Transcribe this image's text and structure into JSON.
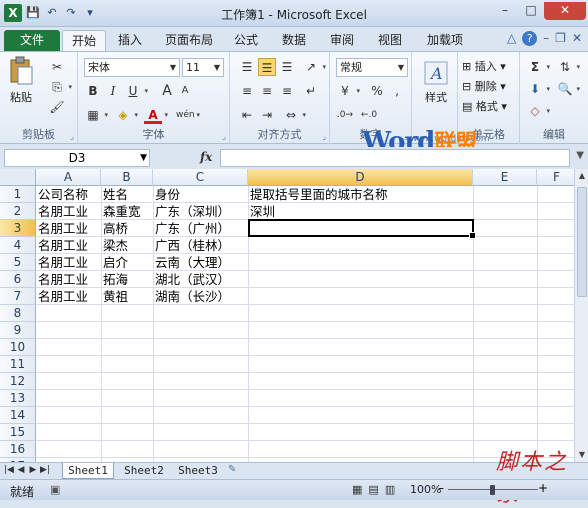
{
  "window": {
    "title": "工作簿1 - Microsoft Excel",
    "controls": [
      "–",
      "□",
      "✕"
    ]
  },
  "qat": {
    "app_icon": "X",
    "save": "💾",
    "undo": "↶",
    "redo": "↷",
    "more": "▾"
  },
  "tabs": [
    "文件",
    "开始",
    "插入",
    "页面布局",
    "公式",
    "数据",
    "审阅",
    "视图",
    "加载项"
  ],
  "ribbon": {
    "clipboard": {
      "paste": "粘贴",
      "label": "剪贴板"
    },
    "font": {
      "name": "宋体",
      "size": "11",
      "bold": "B",
      "italic": "I",
      "underline": "U",
      "grow": "A",
      "shrink": "A",
      "fontcolor": "A",
      "wen": "wén",
      "label": "字体"
    },
    "alignment": {
      "label": "对齐方式"
    },
    "number": {
      "format": "常规",
      "percent": "%",
      "comma": ",",
      "label": "数字"
    },
    "styles": {
      "label": "样式"
    },
    "cells": {
      "insert": "插入",
      "delete": "删除",
      "format": "格式",
      "label": "单元格"
    },
    "editing": {
      "sigma": "Σ",
      "label": "编辑"
    }
  },
  "watermark": {
    "word": "Word",
    "brand": "联盟",
    "url": "www.wordlm.com"
  },
  "formula_bar": {
    "namebox": "D3",
    "fx": "fx",
    "formula": ""
  },
  "columns": [
    "A",
    "B",
    "C",
    "D",
    "E",
    "F"
  ],
  "rows": [
    "1",
    "2",
    "3",
    "4",
    "5",
    "6",
    "7",
    "8",
    "9",
    "10",
    "11",
    "12",
    "13",
    "14",
    "15",
    "16",
    "17"
  ],
  "cells": {
    "A1": "公司名称",
    "B1": "姓名",
    "C1": "身份",
    "D1": "提取括号里面的城市名称",
    "A2": "名朋工业",
    "B2": "森重宽",
    "C2": "广东（深圳）",
    "D2": "深圳",
    "A3": "名朋工业",
    "B3": "高桥",
    "C3": "广东（广州）",
    "A4": "名朋工业",
    "B4": "梁杰",
    "C4": "广西（桂林）",
    "A5": "名朋工业",
    "B5": "启介",
    "C5": "云南（大理）",
    "A6": "名朋工业",
    "B6": "拓海",
    "C6": "湖北（武汉）",
    "A7": "名朋工业",
    "B7": "黄祖",
    "C7": "湖南（长沙）"
  },
  "sheet_tabs": [
    "Sheet1",
    "Sheet2",
    "Sheet3"
  ],
  "status": {
    "mode": "就绪",
    "zoom": "100%",
    "minus": "–",
    "plus": "+"
  },
  "corner_watermark": "脚本之家"
}
